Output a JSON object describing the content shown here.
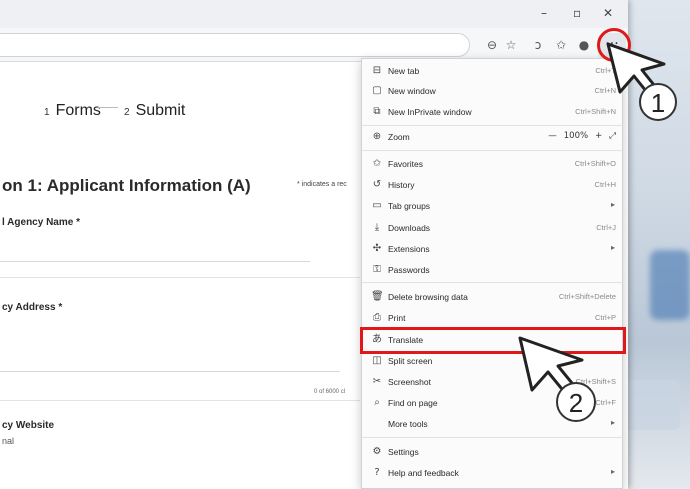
{
  "window": {
    "min_glyph": "–",
    "max_glyph": "▫",
    "close_glyph": "✕"
  },
  "toolbar": {
    "icons": [
      "⊖",
      "☆",
      "ↄ",
      "✩",
      "●"
    ],
    "more_glyph": "···"
  },
  "page": {
    "steps": [
      {
        "num": "1",
        "label": "Forms"
      },
      {
        "num": "2",
        "label": "Submit"
      }
    ],
    "section_title": "on 1: Applicant Information (A)",
    "required_note": "* indicates a rec",
    "fields": [
      {
        "label": "l Agency Name *",
        "sub": ""
      },
      {
        "label": "cy Address *",
        "sub": ""
      },
      {
        "label": "cy Website",
        "sub": "nal"
      }
    ],
    "char_count": "0 of 6000 cl"
  },
  "menu": {
    "items": [
      {
        "icon": "⊟",
        "label": "New tab",
        "shortcut": "Ctrl+T",
        "arrow": false
      },
      {
        "icon": "▢",
        "label": "New window",
        "shortcut": "Ctrl+N",
        "arrow": false
      },
      {
        "icon": "⧉",
        "label": "New InPrivate window",
        "shortcut": "Ctrl+Shift+N",
        "arrow": false
      },
      {
        "icon": "⊕",
        "label": "Zoom",
        "shortcut": "",
        "arrow": false
      },
      {
        "icon": "✩",
        "label": "Favorites",
        "shortcut": "Ctrl+Shift+O",
        "arrow": false
      },
      {
        "icon": "↺",
        "label": "History",
        "shortcut": "Ctrl+H",
        "arrow": false
      },
      {
        "icon": "▭",
        "label": "Tab groups",
        "shortcut": "",
        "arrow": true
      },
      {
        "icon": "⤓",
        "label": "Downloads",
        "shortcut": "Ctrl+J",
        "arrow": false
      },
      {
        "icon": "✣",
        "label": "Extensions",
        "shortcut": "",
        "arrow": true
      },
      {
        "icon": "⚿",
        "label": "Passwords",
        "shortcut": "",
        "arrow": false
      },
      {
        "icon": "🗑",
        "label": "Delete browsing data",
        "shortcut": "Ctrl+Shift+Delete",
        "arrow": false
      },
      {
        "icon": "⎙",
        "label": "Print",
        "shortcut": "Ctrl+P",
        "arrow": false
      },
      {
        "icon": "あ",
        "label": "Translate",
        "shortcut": "",
        "arrow": false
      },
      {
        "icon": "◫",
        "label": "Split screen",
        "shortcut": "",
        "arrow": false
      },
      {
        "icon": "✂",
        "label": "Screenshot",
        "shortcut": "Ctrl+Shift+S",
        "arrow": false
      },
      {
        "icon": "⌕",
        "label": "Find on page",
        "shortcut": "Ctrl+F",
        "arrow": false
      },
      {
        "icon": "",
        "label": "More tools",
        "shortcut": "",
        "arrow": true
      },
      {
        "icon": "⚙",
        "label": "Settings",
        "shortcut": "",
        "arrow": false
      },
      {
        "icon": "?",
        "label": "Help and feedback",
        "shortcut": "",
        "arrow": true
      }
    ],
    "zoom": {
      "minus": "—",
      "value": "100%",
      "plus": "+",
      "expand": "⤢"
    },
    "arrow_glyph": "▸"
  },
  "annotations": {
    "badge1": "1",
    "badge2": "2",
    "highlight_color": "#e01818"
  }
}
